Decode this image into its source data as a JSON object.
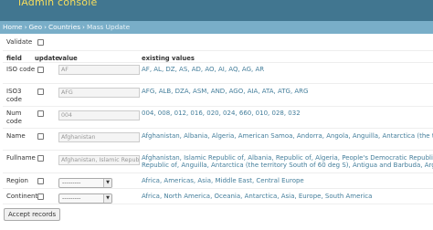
{
  "header": {
    "title": "iAdmin console"
  },
  "breadcrumb": {
    "items": [
      "Home",
      "Geo",
      "Countries",
      "Mass Update"
    ],
    "separator": "›"
  },
  "validate": {
    "label": "Validate"
  },
  "columns": {
    "field": "field",
    "update": "update",
    "value": "value",
    "existing": "existing values"
  },
  "rows": [
    {
      "label": "ISO code",
      "value": "AF",
      "existing": "AF, AL, DZ, AS, AD, AO, AI, AQ, AG, AR"
    },
    {
      "label": "ISO3 code",
      "value": "AFG",
      "existing": "AFG, ALB, DZA, ASM, AND, AGO, AIA, ATA, ATG, ARG"
    },
    {
      "label": "Num code",
      "value": "004",
      "existing": "004, 008, 012, 016, 020, 024, 660, 010, 028, 032"
    },
    {
      "label": "Name",
      "value": "Afghanistan",
      "existing": "Afghanistan, Albania, Algeria, American Samoa, Andorra, Angola, Anguilla, Antarctica (the territory South of 60 deg"
    },
    {
      "label": "Fullname",
      "value": "Afghanistan, Islamic Republic",
      "existing_line1": "Afghanistan, Islamic Republic of, Albania, Republic of, Algeria, People's Democratic Republic of, American Samoa,",
      "existing_line2": "Republic of, Anguilla, Antarctica (the territory South of 60 deg S), Antigua and Barbuda, Argentina, Argentine Republic"
    },
    {
      "label": "Region",
      "value": "---------",
      "existing": "Africa, Americas, Asia, Middle East, Central Europe"
    },
    {
      "label": "Continent",
      "value": "---------",
      "existing": "Africa, North America, Oceania, Antarctica, Asia, Europe, South America"
    }
  ],
  "submit": {
    "label": "Accept records"
  },
  "colors": {
    "header": "#417690",
    "breadcrumb": "#79aec8",
    "title": "#f5dd5d",
    "link": "#447e9b"
  }
}
